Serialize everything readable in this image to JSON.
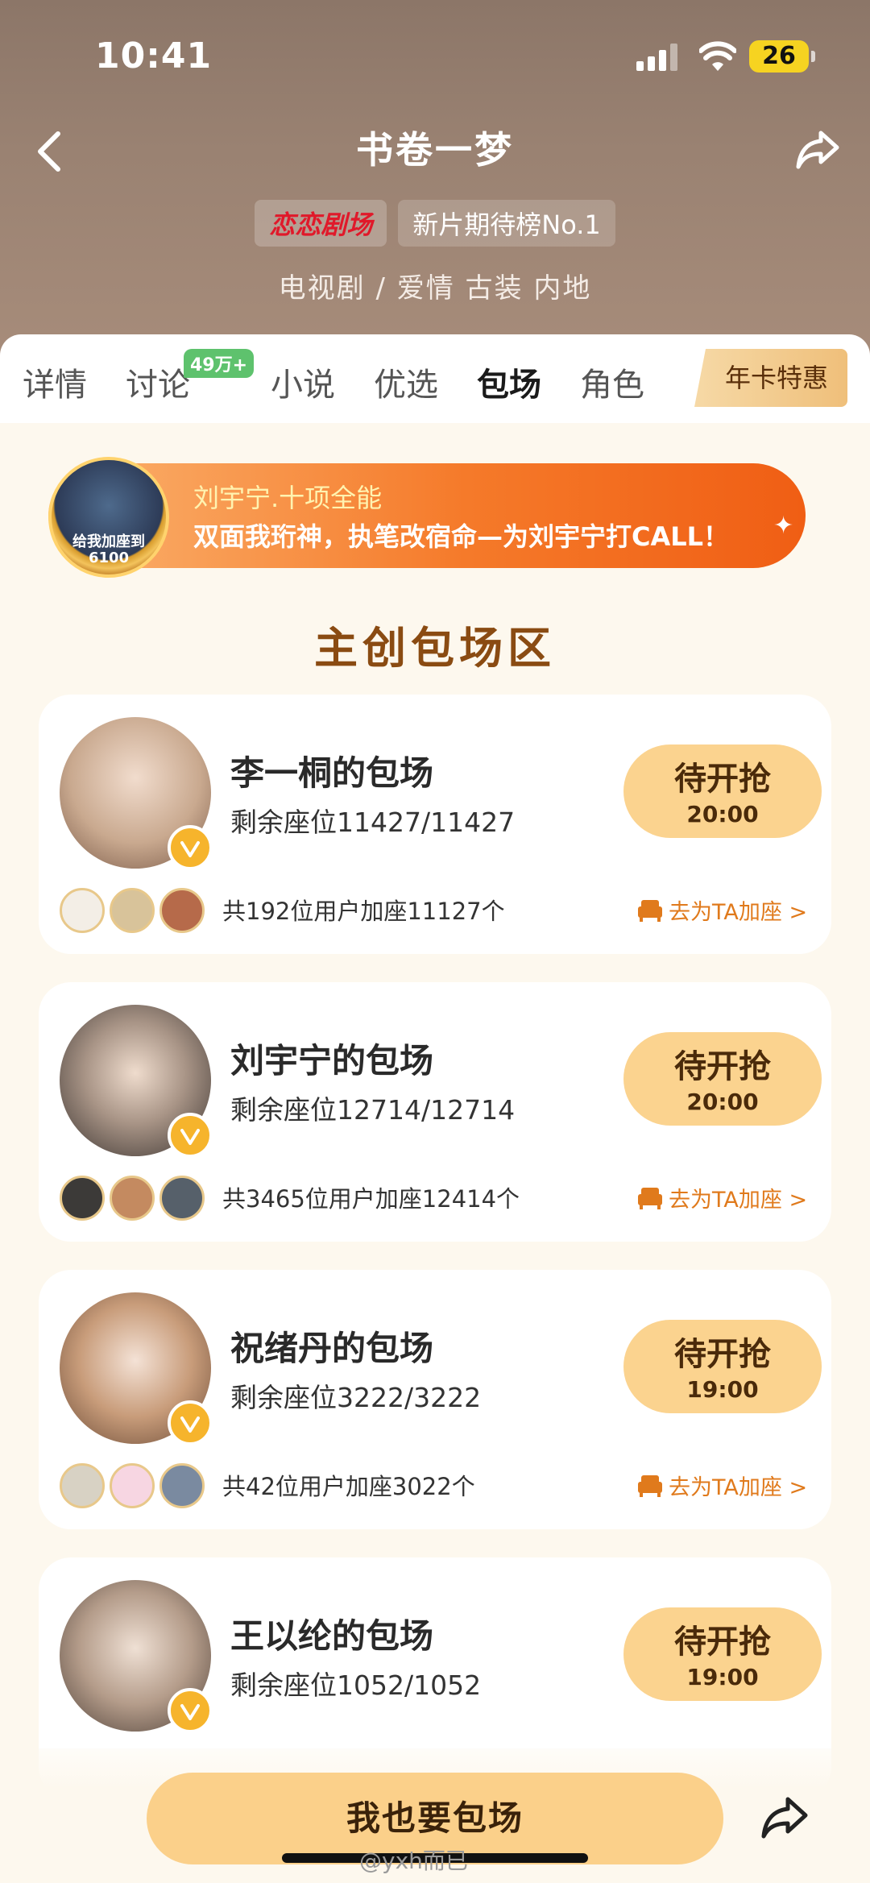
{
  "status_bar": {
    "time": "10:41",
    "battery": "26"
  },
  "nav": {
    "title": "书卷一梦"
  },
  "badges": {
    "brand": "恋恋剧场",
    "rank": "新片期待榜No.1"
  },
  "genre": "电视剧 / 爱情 古装 内地",
  "tabs": {
    "items": [
      "详情",
      "讨论",
      "小说",
      "优选",
      "包场",
      "角色"
    ],
    "discussion_badge": "49万+",
    "active": "包场",
    "vip": "年卡特惠"
  },
  "banner": {
    "avatar_text": "给我加座到 6100",
    "title": "刘宇宁.十项全能",
    "subtitle": "双面我珩神，执笔改宿命—为刘宇宁打CALL！"
  },
  "section_title": "主创包场区",
  "cards": [
    {
      "name": "李一桐的包场",
      "seats": "剩余座位11427/11427",
      "status": "待开抢",
      "time": "20:00",
      "count": "共192位用户加座11127个",
      "action": "去为TA加座 >",
      "avatar_color": "#c9a98f"
    },
    {
      "name": "刘宇宁的包场",
      "seats": "剩余座位12714/12714",
      "status": "待开抢",
      "time": "20:00",
      "count": "共3465位用户加座12414个",
      "action": "去为TA加座 >",
      "avatar_color": "#7d7164"
    },
    {
      "name": "祝绪丹的包场",
      "seats": "剩余座位3222/3222",
      "status": "待开抢",
      "time": "19:00",
      "count": "共42位用户加座3022个",
      "action": "去为TA加座 >",
      "avatar_color": "#b48966"
    },
    {
      "name": "王以纶的包场",
      "seats": "剩余座位1052/1052",
      "status": "待开抢",
      "time": "19:00",
      "avatar_color": "#a7968a"
    }
  ],
  "bottom": {
    "cta": "我也要包场",
    "watermark": "@yxh而已"
  },
  "colors": {
    "accent": "#f57a2a",
    "button": "#fbd38f",
    "title_brown": "#8a4b12"
  }
}
